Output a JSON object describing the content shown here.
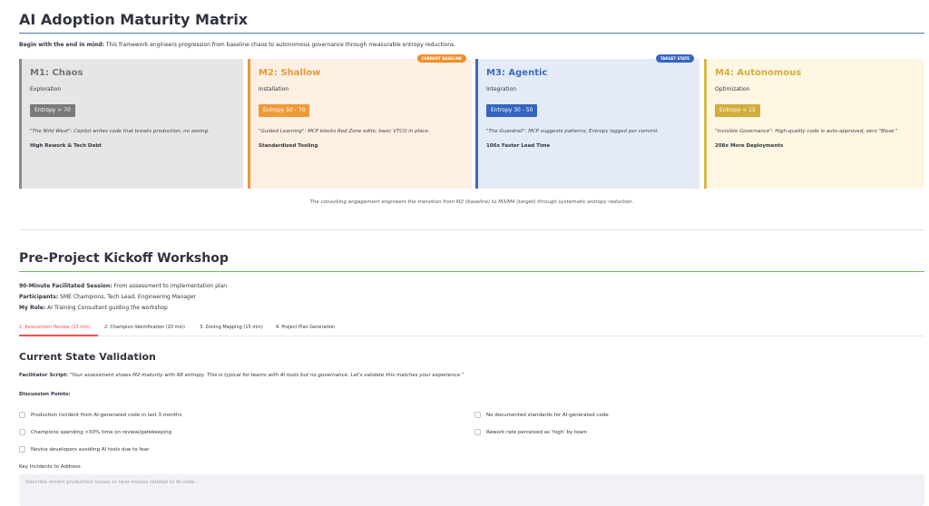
{
  "matrix": {
    "title": "AI Adoption Maturity Matrix",
    "intro_bold": "Begin with the end in mind:",
    "intro_text": " This framework engineers progression from baseline chaos to autonomous governance through measurable entropy reductions.",
    "cards": [
      {
        "title": "M1: Chaos",
        "phase": "Exploration",
        "entropy": "Entropy > 70",
        "quote": "\"The Wild West\": Copilot writes code that breaks production; no zoning.",
        "outcome": "High Rework & Tech Debt",
        "tag": ""
      },
      {
        "title": "M2: Shallow",
        "phase": "Installation",
        "entropy": "Entropy 50 - 70",
        "quote": "\"Guided Learning\": MCP blocks Red Zone edits; basic VTCO in place.",
        "outcome": "Standardized Tooling",
        "tag": "CURRENT BASELINE"
      },
      {
        "title": "M3: Agentic",
        "phase": "Integration",
        "entropy": "Entropy 30 - 50",
        "quote": "\"The Guardrail\": MCP suggests patterns; Entropy logged per commit.",
        "outcome": "106x Faster Lead Time",
        "tag": "TARGET STATE"
      },
      {
        "title": "M4: Autonomous",
        "phase": "Optimization",
        "entropy": "Entropy < 15",
        "quote": "\"Invisible Governance\": High-quality code is auto-approved; zero \"Bloat.\"",
        "outcome": "208x More Deployments",
        "tag": ""
      }
    ],
    "caption": "The consulting engagement engineers the transition from M2 (baseline) to M3/M4 (target) through systematic entropy reduction."
  },
  "workshop": {
    "title": "Pre-Project Kickoff Workshop",
    "session_label": "90-Minute Facilitated Session:",
    "session_text": " From assessment to implementation plan",
    "participants_label": "Participants:",
    "participants_text": " SME Champions, Tech Lead, Engineering Manager",
    "role_label": "My Role:",
    "role_text": " AI Training Consultant guiding the workshop",
    "tabs": [
      "1. Assessment Review (15 min)",
      "2. Champion Identification (20 min)",
      "3. Zoning Mapping (15 min)",
      "4. Project Plan Generation"
    ],
    "active_tab": 0
  },
  "validation": {
    "title": "Current State Validation",
    "script_label": "Facilitator Script:",
    "script_text": " \"Your assessment shows M2 maturity with 68 entropy. This is typical for teams with AI tools but no governance. Let's validate this matches your experience.\"",
    "discussion_label": "Discussion Points:",
    "checks_left": [
      "Production incident from AI-generated code in last 3 months",
      "Champions spending >50% time on review/gatekeeping",
      "Novice developers avoiding AI tools due to fear"
    ],
    "checks_right": [
      "No documented standards for AI-generated code",
      "Rework rate perceived as 'high' by team"
    ],
    "incidents_label": "Key Incidents to Address",
    "incidents_placeholder": "Describe recent production issues or near-misses related to AI code..."
  }
}
